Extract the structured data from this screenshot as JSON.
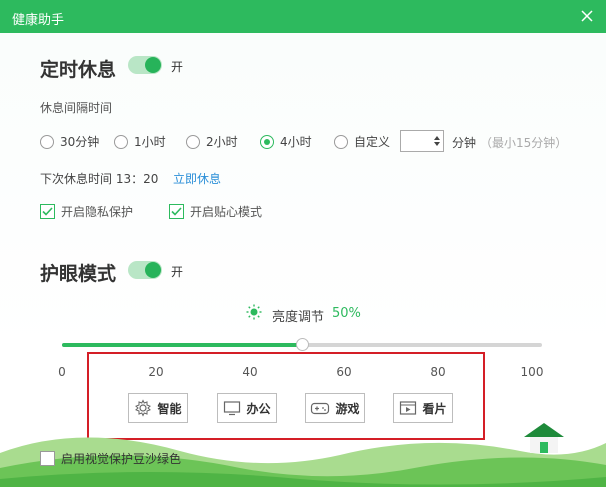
{
  "window": {
    "title": "健康助手"
  },
  "timed_rest": {
    "title": "定时休息",
    "toggle_label": "开",
    "interval_label": "休息间隔时间",
    "options": [
      {
        "label": "30分钟",
        "selected": false
      },
      {
        "label": "1小时",
        "selected": false
      },
      {
        "label": "2小时",
        "selected": false
      },
      {
        "label": "4小时",
        "selected": true
      },
      {
        "label": "自定义",
        "selected": false
      }
    ],
    "custom_value": "",
    "custom_unit": "分钟",
    "custom_hint": "（最小15分钟）",
    "next_rest_label": "下次休息时间 13：20",
    "rest_now_link": "立即休息",
    "privacy_label": "开启隐私保护",
    "care_label": "开启贴心模式"
  },
  "eye_care": {
    "title": "护眼模式",
    "toggle_label": "开",
    "brightness_label": "亮度调节",
    "brightness_value": "50%",
    "brightness_fraction": 0.5,
    "ticks": [
      "0",
      "20",
      "40",
      "60",
      "80",
      "100"
    ],
    "modes": [
      {
        "label": "智能",
        "icon": "smart-gear-icon"
      },
      {
        "label": "办公",
        "icon": "monitor-icon"
      },
      {
        "label": "游戏",
        "icon": "gamepad-icon"
      },
      {
        "label": "看片",
        "icon": "film-icon"
      }
    ]
  },
  "footer": {
    "bean_green_label": "启用视觉保护豆沙绿色"
  },
  "colors": {
    "brand": "#2dba5e",
    "link": "#2b8fd8",
    "highlight": "#d41e26"
  }
}
